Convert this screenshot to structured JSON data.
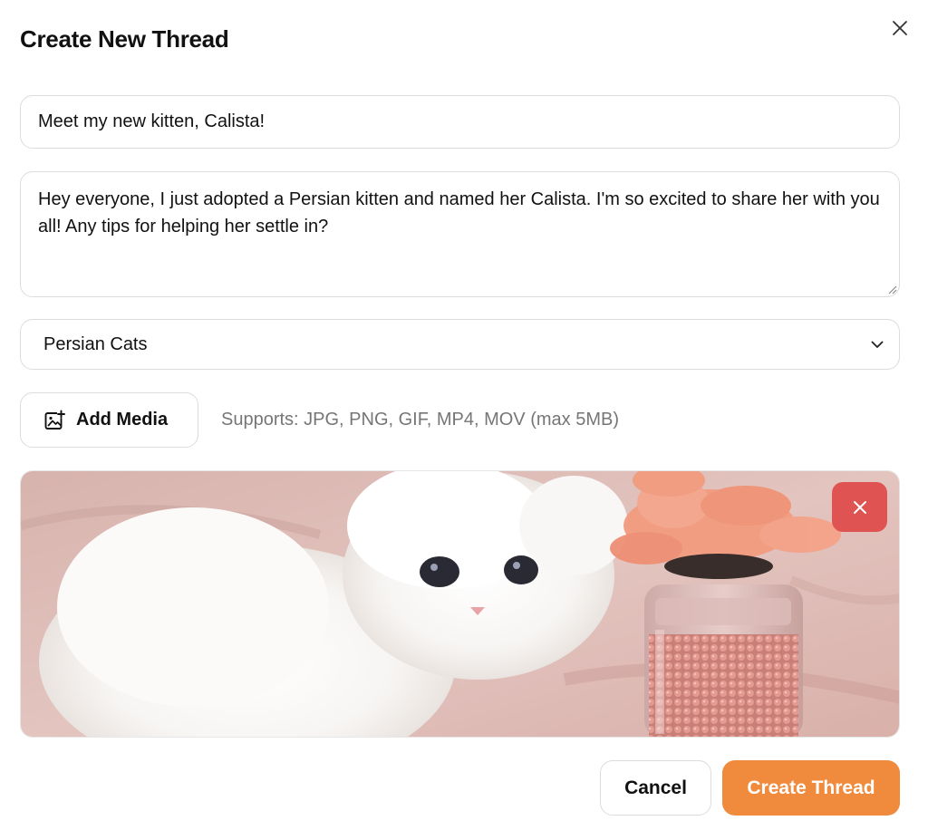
{
  "dialog": {
    "title": "Create New Thread"
  },
  "form": {
    "thread_title": "Meet my new kitten, Calista!",
    "thread_body": "Hey everyone, I just adopted a Persian kitten and named her Calista. I'm so excited to share her with you all! Any tips for helping her settle in?",
    "category_selected": "Persian Cats"
  },
  "media": {
    "add_label": "Add Media",
    "supports_text": "Supports: JPG, PNG, GIF, MP4, MOV (max 5MB)"
  },
  "actions": {
    "cancel_label": "Cancel",
    "create_label": "Create Thread"
  },
  "colors": {
    "accent": "#f08a3c",
    "danger": "#e05353",
    "border": "#dcdcdc",
    "muted_text": "#767676"
  },
  "icons": {
    "close": "close-icon",
    "dropdown": "chevron-down-icon",
    "add_media": "image-plus-icon",
    "remove": "close-icon"
  }
}
